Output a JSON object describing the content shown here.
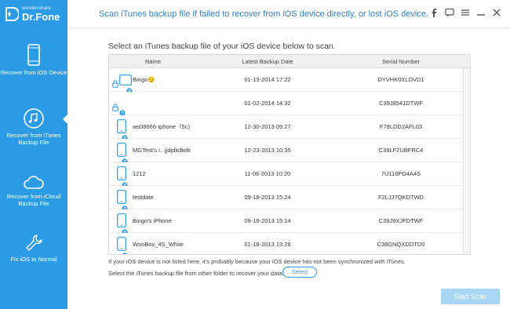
{
  "app": {
    "brand": "wondershare",
    "name": "Dr.Fone"
  },
  "header": {
    "title": "Scan iTunes backup file if failed to recover from iOS device directly, or lost iOS device."
  },
  "window_controls": [
    "facebook-icon",
    "feedback-icon",
    "menu-icon",
    "minimize-icon",
    "close-icon"
  ],
  "sidebar": {
    "items": [
      {
        "label": "Recover from iOS Device",
        "icon": "phone-icon"
      },
      {
        "label": "Recover from iTunes Backup File",
        "icon": "music-note-icon",
        "active": true
      },
      {
        "label": "Recover from iCloud Backup File",
        "icon": "cloud-icon"
      },
      {
        "label": "Fix iOS to Normal",
        "icon": "wrench-icon"
      }
    ]
  },
  "main": {
    "instruction": "Select an iTunes backup file of your iOS device below to scan.",
    "table": {
      "columns": [
        "Name",
        "Latest Backup Date",
        "Serial Number"
      ],
      "rows": [
        {
          "name": "Bingo😏",
          "date": "01-13-2014 17:22",
          "serial": "DYVHK0XLDVD1",
          "locked": true,
          "device": "tablet"
        },
        {
          "name": "",
          "date": "01-02-2014 14:32",
          "serial": "C39J8541DTWF",
          "locked": true,
          "device": "none"
        },
        {
          "name": "ws08666-iphone（5c)",
          "date": "12-30-2013 09:27",
          "serial": "F78LDD2AFL03",
          "locked": false,
          "device": "phone"
        },
        {
          "name": "MGTest's i...jjdjdkdkdk",
          "date": "12-23-2013 10:35",
          "serial": "C39LF2UBFRC4",
          "locked": false,
          "device": "phone"
        },
        {
          "name": "1212",
          "date": "11-06-2013 10:20",
          "serial": "7U116PD4A4S",
          "locked": false,
          "device": "phone"
        },
        {
          "name": "testdate",
          "date": "09-18-2013 15:24",
          "serial": "F2LJJ7QKDTWD",
          "locked": false,
          "device": "phone"
        },
        {
          "name": "Bingo's iPhone",
          "date": "09-18-2013 15:14",
          "serial": "C39J9XJFDTWF",
          "locked": false,
          "device": "phone"
        },
        {
          "name": "WonBox_4S_White",
          "date": "01-18-2013 13:28",
          "serial": "C38GNQXDDTD0",
          "locked": false,
          "device": "phone"
        }
      ]
    },
    "note_not_listed": "If your iOS device is not listed here, it's probably because your iOS device has not been synchronized with iTunes.",
    "note_select_other": "Select the iTunes backup file from other folder to recover your data.",
    "select_label": "Select",
    "start_scan_label": "Start Scan"
  },
  "colors": {
    "sidebar": "#2b9be6",
    "accent": "#2b9be6",
    "start_scan_disabled": "#a9d6f5"
  }
}
